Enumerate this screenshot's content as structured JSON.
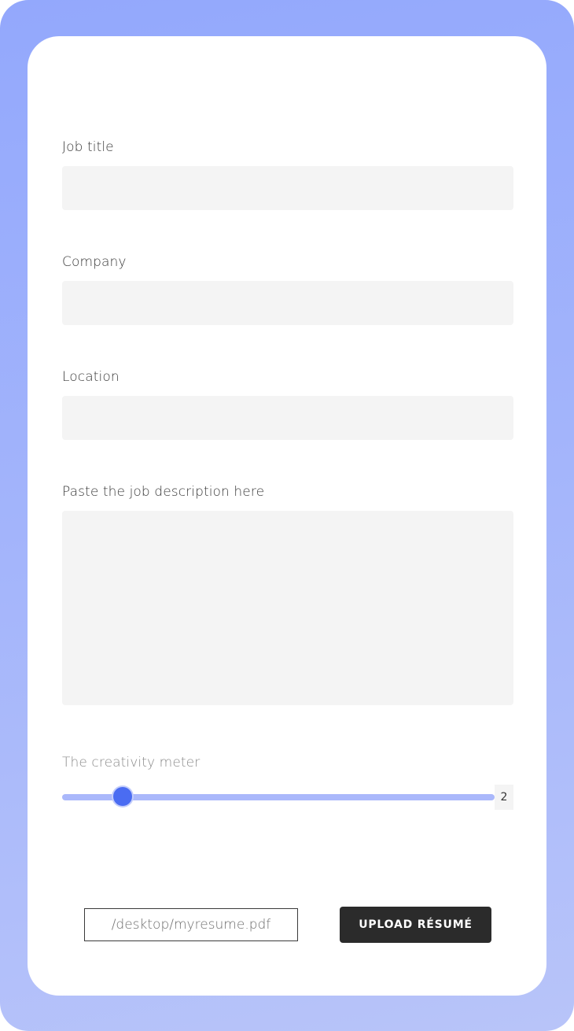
{
  "form": {
    "job_title": {
      "label": "Job title",
      "value": "",
      "placeholder": ""
    },
    "company": {
      "label": "Company",
      "value": "",
      "placeholder": ""
    },
    "location": {
      "label": "Location",
      "value": "",
      "placeholder": ""
    },
    "job_description": {
      "label": "Paste the job description here",
      "value": "",
      "placeholder": ""
    }
  },
  "creativity_meter": {
    "label": "The creativity meter",
    "value": "2",
    "fraction": 0.14
  },
  "upload": {
    "file_path": "/desktop/myresume.pdf",
    "button_label": "UPLOAD RÉSUMÉ"
  },
  "colors": {
    "background_gradient_start": "#93a8fc",
    "background_gradient_end": "#b8c4f9",
    "card": "#ffffff",
    "field": "#f4f4f4",
    "slider_track": "#aab8fb",
    "slider_thumb": "#4a6cf2",
    "button": "#2b2b2b"
  }
}
